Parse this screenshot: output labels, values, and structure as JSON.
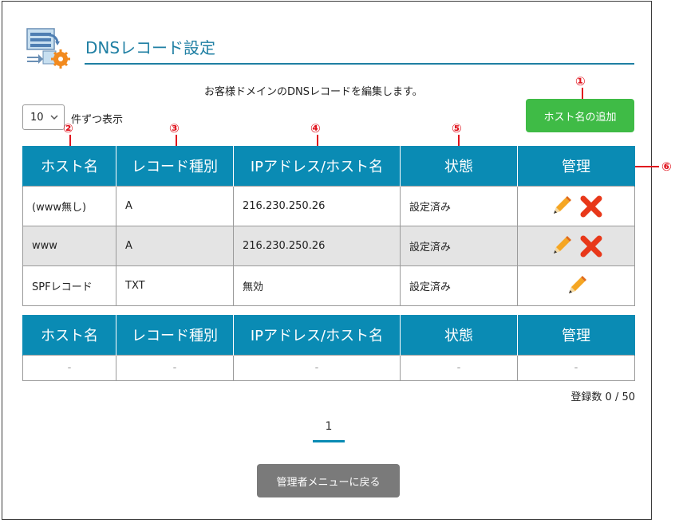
{
  "header": {
    "title": "DNSレコード設定"
  },
  "description": "お客様ドメインのDNSレコードを編集します。",
  "per_page": {
    "value": "10",
    "label": "件ずつ表示"
  },
  "add_host_button": "ホスト名の追加",
  "markers": [
    "①",
    "②",
    "③",
    "④",
    "⑤",
    "⑥"
  ],
  "columns": [
    "ホスト名",
    "レコード種別",
    "IPアドレス/ホスト名",
    "状態",
    "管理"
  ],
  "records": [
    {
      "host": "(www無し)",
      "type": "A",
      "ip": "216.230.250.26",
      "status": "設定済み",
      "deletable": true
    },
    {
      "host": "www",
      "type": "A",
      "ip": "216.230.250.26",
      "status": "設定済み",
      "deletable": true
    },
    {
      "host": "SPFレコード",
      "type": "TXT",
      "ip": "無効",
      "status": "設定済み",
      "deletable": false
    }
  ],
  "empty_row": [
    "-",
    "-",
    "-",
    "-",
    "-"
  ],
  "count_label": "登録数 0 / 50",
  "pagination": {
    "current": "1"
  },
  "back_button": "管理者メニューに戻る",
  "colors": {
    "accent": "#0a8bb4",
    "title": "#1f7fa3",
    "add": "#3fbb46",
    "back": "#7a7a7a",
    "marker": "#e0131d"
  },
  "icons": {
    "edit": "pencil-icon",
    "delete": "cross-icon",
    "header": "dns-settings-icon"
  }
}
